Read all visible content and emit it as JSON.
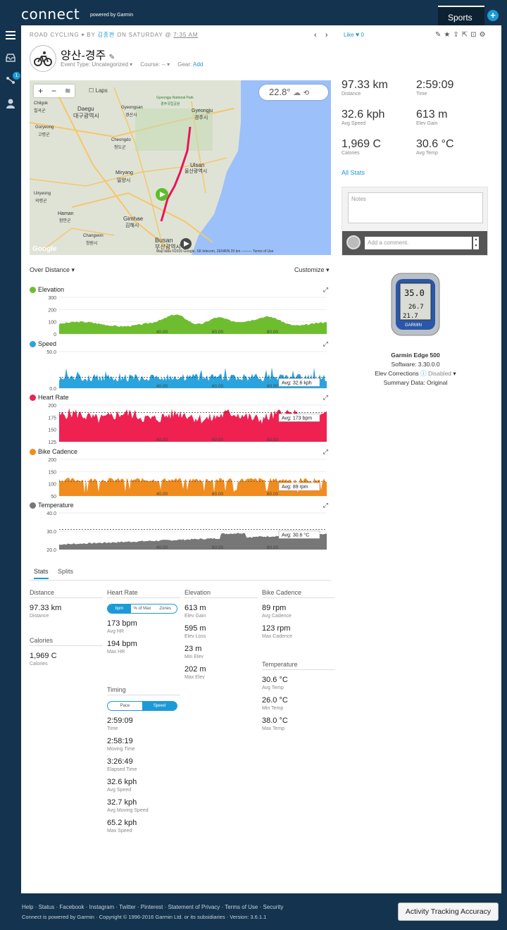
{
  "brand": {
    "logo": "connect",
    "sub": "powered by Garmin"
  },
  "header": {
    "sports": "Sports",
    "plus": "+"
  },
  "nav": {
    "badge": "1"
  },
  "activity": {
    "crumb_type": "ROAD CYCLING",
    "crumb_by": "BY",
    "crumb_user": "김종판",
    "crumb_on": "ON SATURDAY @",
    "crumb_time": "7:35 AM",
    "title": "양산-경주",
    "event_type_label": "Event Type:",
    "event_type": "Uncategorized",
    "course_label": "Course:",
    "course": "--",
    "gear_label": "Gear:",
    "gear_add": "Add",
    "like": "Like",
    "like_count": "0"
  },
  "map": {
    "laps": "Laps",
    "temp": "22.8°",
    "attribution": "Map data ©2016 Google, SK telecom, ZENRIN   20 km ———   Terms of Use",
    "google": "Google",
    "places": [
      "Daegu",
      "대구광역시",
      "Gyeongsan",
      "경산시",
      "Gyeongju",
      "경주시",
      "Gyeongju National Park",
      "경주국립공원",
      "Cheongdo",
      "청도군",
      "Miryang",
      "밀양시",
      "Ulsan",
      "울산광역시",
      "Gimhae",
      "김해시",
      "Busan",
      "부산광역시",
      "Haman",
      "함안군",
      "Changwon",
      "창원시",
      "Uiryeong",
      "의령군",
      "Goryeong",
      "고령군",
      "Chilgok",
      "칠곡군"
    ]
  },
  "graphs": {
    "over_distance": "Over Distance",
    "customize": "Customize",
    "items": [
      {
        "name": "Elevation",
        "color": "#6ebd2f",
        "yticks": [
          "300",
          "200",
          "100",
          "0"
        ],
        "xticks": [
          "40.00",
          "60.00",
          "80.00"
        ],
        "avg": ""
      },
      {
        "name": "Speed",
        "color": "#2ba3dc",
        "yticks": [
          "50.0",
          "0.0"
        ],
        "xticks": [
          "40.00",
          "60.00",
          "80.00"
        ],
        "avg": "Avg: 32.6 kph"
      },
      {
        "name": "Heart Rate",
        "color": "#ee2150",
        "yticks": [
          "200",
          "175",
          "150",
          "125"
        ],
        "xticks": [
          "40.00",
          "60.00",
          "80.00"
        ],
        "avg": "Avg: 173 bpm"
      },
      {
        "name": "Bike Cadence",
        "color": "#f08c1e",
        "yticks": [
          "200",
          "150",
          "100",
          "50"
        ],
        "xticks": [
          "40.00",
          "60.00",
          "80.00"
        ],
        "avg": "Avg: 89 rpm"
      },
      {
        "name": "Temperature",
        "color": "#777777",
        "yticks": [
          "40.0",
          "30.0",
          "20.0"
        ],
        "xticks": [
          "40.00",
          "60.00",
          "80.00"
        ],
        "avg": "Avg: 30.6 °C"
      }
    ]
  },
  "summary": [
    {
      "value": "97.33 km",
      "label": "Distance"
    },
    {
      "value": "2:59:09",
      "label": "Time"
    },
    {
      "value": "32.6 kph",
      "label": "Avg Speed"
    },
    {
      "value": "613 m",
      "label": "Elev Gain"
    },
    {
      "value": "1,969 C",
      "label": "Calories"
    },
    {
      "value": "30.6 °C",
      "label": "Avg Temp"
    }
  ],
  "all_stats": "All Stats",
  "notes": {
    "placeholder": "Notes",
    "comment": "Add a comment."
  },
  "device": {
    "name": "Garmin Edge 500",
    "software": "Software: 3.30.0.0",
    "elev_label": "Elev Corrections",
    "elev_value": "Disabled",
    "summary_data": "Summary Data: Original",
    "screen": [
      "35.0",
      "26.7",
      "21.7"
    ],
    "brand": "GARMIN"
  },
  "tabs": {
    "stats": "Stats",
    "splits": "Splits"
  },
  "stats": {
    "distance": {
      "head": "Distance",
      "items": [
        {
          "v": "97.33 km",
          "l": "Distance"
        }
      ]
    },
    "calories": {
      "head": "Calories",
      "items": [
        {
          "v": "1,969 C",
          "l": "Calories"
        }
      ]
    },
    "heart": {
      "head": "Heart Rate",
      "seg": [
        "bpm",
        "% of Max",
        "Zones"
      ],
      "items": [
        {
          "v": "173 bpm",
          "l": "Avg HR"
        },
        {
          "v": "194 bpm",
          "l": "Max HR"
        }
      ]
    },
    "timing": {
      "head": "Timing",
      "seg": [
        "Pace",
        "Speed"
      ],
      "items": [
        {
          "v": "2:59:09",
          "l": "Time"
        },
        {
          "v": "2:58:19",
          "l": "Moving Time"
        },
        {
          "v": "3:26:49",
          "l": "Elapsed Time"
        },
        {
          "v": "32.6 kph",
          "l": "Avg Speed"
        },
        {
          "v": "32.7 kph",
          "l": "Avg Moving Speed"
        },
        {
          "v": "65.2 kph",
          "l": "Max Speed"
        }
      ]
    },
    "elevation": {
      "head": "Elevation",
      "items": [
        {
          "v": "613 m",
          "l": "Elev Gain"
        },
        {
          "v": "595 m",
          "l": "Elev Loss"
        },
        {
          "v": "23 m",
          "l": "Min Elev"
        },
        {
          "v": "202 m",
          "l": "Max Elev"
        }
      ]
    },
    "cadence": {
      "head": "Bike Cadence",
      "items": [
        {
          "v": "89 rpm",
          "l": "Avg Cadence"
        },
        {
          "v": "123 rpm",
          "l": "Max Cadence"
        }
      ]
    },
    "temperature": {
      "head": "Temperature",
      "items": [
        {
          "v": "30.6 °C",
          "l": "Avg Temp"
        },
        {
          "v": "26.0 °C",
          "l": "Min Temp"
        },
        {
          "v": "38.0 °C",
          "l": "Max Temp"
        }
      ]
    }
  },
  "footer": {
    "links": "Help · Status · Facebook · Instagram · Twitter · Pinterest · Statement of Privacy · Terms of Use · Security",
    "copy": "Connect is powered by Garmin · Copyright © 1996-2016 Garmin Ltd. or its subsidiaries · Version: 3.6.1.1",
    "button": "Activity Tracking Accuracy"
  }
}
